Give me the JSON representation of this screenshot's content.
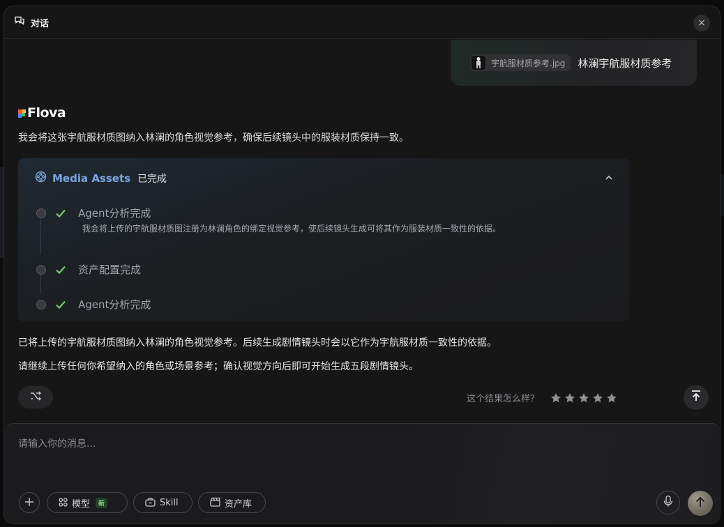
{
  "header": {
    "title": "对话",
    "close_label": "×"
  },
  "user_message": {
    "file_name": "宇航服材质参考.jpg",
    "text": "林澜宇航服材质参考"
  },
  "assistant": {
    "brand": "Flova",
    "intro": "我会将这张宇航服材质图纳入林澜的角色视觉参考，确保后续镜头中的服装材质保持一致。",
    "assets_panel": {
      "title": "Media Assets",
      "status": "已完成",
      "steps": [
        {
          "label": "Agent分析完成",
          "description": "我会将上传的宇航服材质图注册为林澜角色的绑定视觉参考，使后续镜头生成可将其作为服装材质一致性的依据。"
        },
        {
          "label": "资产配置完成"
        },
        {
          "label": "Agent分析完成"
        }
      ]
    },
    "result_line1": "已将上传的宇航服材质图纳入林澜的角色视觉参考。后续生成剧情镜头时会以它作为宇航服材质一致性的依据。",
    "result_line2": "请继续上传任何你希望纳入的角色或场景参考；确认视觉方向后即可开始生成五段剧情镜头。"
  },
  "feedback": {
    "question": "这个结果怎么样？",
    "rating": 0,
    "max_rating": 5
  },
  "composer": {
    "placeholder": "请输入你的消息...",
    "value": "",
    "model_label": "模型",
    "model_badge": "新",
    "skill_label": "Skill",
    "assets_label": "资产库"
  },
  "colors": {
    "accent_blue": "#7aa6e0",
    "check_green": "#6fcf6a",
    "new_badge": "#7ed07a"
  }
}
